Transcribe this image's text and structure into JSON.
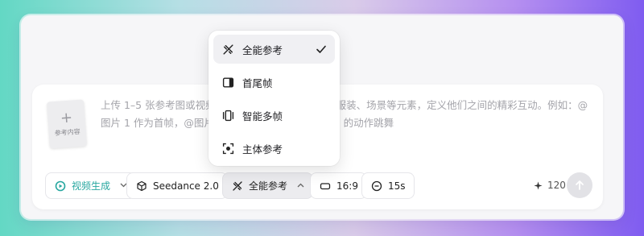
{
  "prompt": {
    "reference_tile_label": "参考内容",
    "placeholder": "上传 1–5 张参考图或视频，描述想要的角色、道具、服装、场景等元素，定义他们之间的精彩互动。例如：@图片 1 作为首帧，@图片 2 作为尾帧，模仿 @视频 1 的动作跳舞"
  },
  "toolbar": {
    "mode_label": "视频生成",
    "model_label": "Seedance 2.0",
    "reference_label": "全能参考",
    "ratio_label": "16:9",
    "duration_label": "15s",
    "credits": "120"
  },
  "dropdown": {
    "items": [
      {
        "label": "全能参考",
        "icon": "omni-reference-icon",
        "selected": true
      },
      {
        "label": "首尾帧",
        "icon": "first-last-frame-icon",
        "selected": false
      },
      {
        "label": "智能多帧",
        "icon": "smart-multi-frame-icon",
        "selected": false
      },
      {
        "label": "主体参考",
        "icon": "subject-reference-icon",
        "selected": false
      }
    ]
  },
  "colors": {
    "accent": "#27a7a0",
    "send_button": "#e2e2e6"
  }
}
